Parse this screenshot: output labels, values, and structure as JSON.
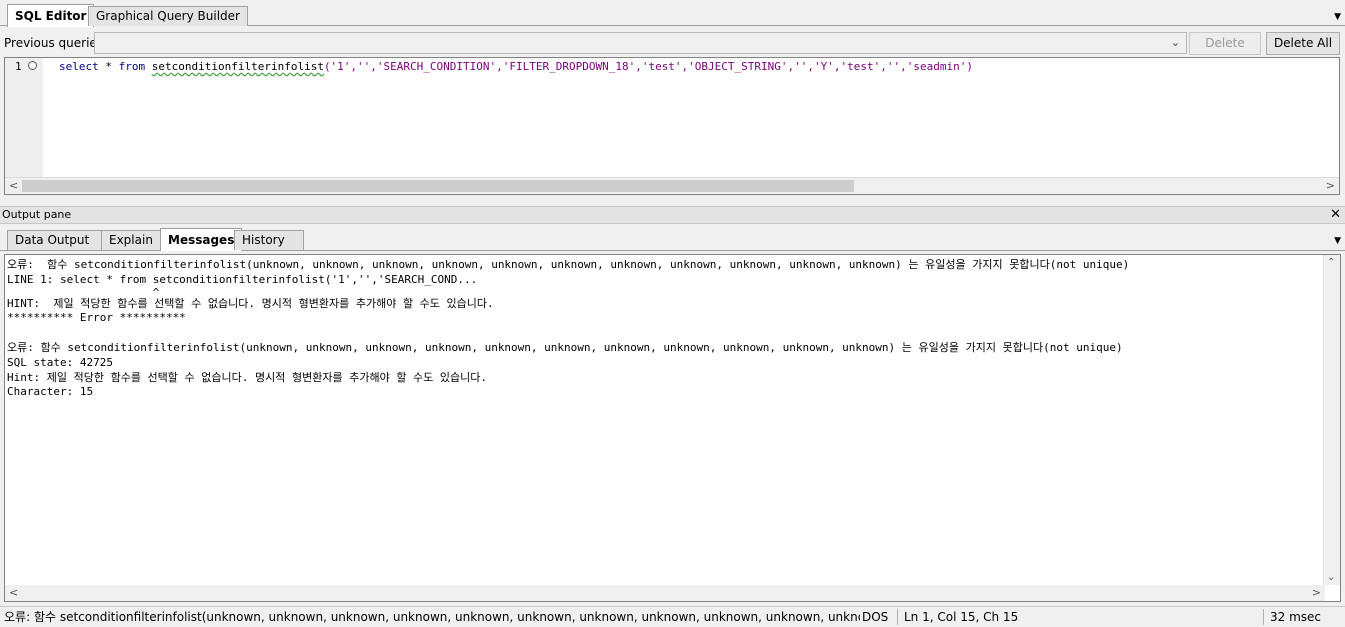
{
  "top_tabs": [
    {
      "label": "SQL Editor",
      "active": true
    },
    {
      "label": "Graphical Query Builder",
      "active": false
    }
  ],
  "previous_queries": {
    "label": "Previous queries",
    "value": "",
    "delete_label": "Delete",
    "delete_all_label": "Delete All"
  },
  "editor": {
    "line_number": "1",
    "kw_select": "select",
    "op_star": " * ",
    "kw_from": "from",
    "space": " ",
    "function_name": "setconditionfilterinfolist",
    "args": "('1','','SEARCH_CONDITION','FILTER_DROPDOWN_18','test','OBJECT_STRING','','Y','test','','seadmin')"
  },
  "output_pane": {
    "title": "Output pane",
    "tabs": [
      {
        "label": "Data Output",
        "active": false
      },
      {
        "label": "Explain",
        "active": false
      },
      {
        "label": "Messages",
        "active": true
      },
      {
        "label": "History",
        "active": false
      }
    ],
    "messages": [
      "오류:  함수 setconditionfilterinfolist(unknown, unknown, unknown, unknown, unknown, unknown, unknown, unknown, unknown, unknown, unknown) 는 유일성을 가지지 못합니다(not unique)",
      "LINE 1: select * from setconditionfilterinfolist('1','','SEARCH_COND...",
      "                      ^",
      "HINT:  제일 적당한 함수를 선택할 수 없습니다. 명시적 형변환자를 추가해야 할 수도 있습니다.",
      "********** Error **********",
      "",
      "오류: 함수 setconditionfilterinfolist(unknown, unknown, unknown, unknown, unknown, unknown, unknown, unknown, unknown, unknown, unknown) 는 유일성을 가지지 못합니다(not unique)",
      "SQL state: 42725",
      "Hint: 제일 적당한 함수를 선택할 수 없습니다. 명시적 형변환자를 추가해야 할 수도 있습니다.",
      "Character: 15"
    ]
  },
  "status_bar": {
    "message": "오류: 함수 setconditionfilterinfolist(unknown, unknown, unknown, unknown, unknown, unknown, unknown, unknown, unknown, unknown, unknown) 는 유",
    "line_ending": "DOS",
    "position": "Ln 1, Col 15, Ch 15",
    "duration": "32 msec"
  }
}
